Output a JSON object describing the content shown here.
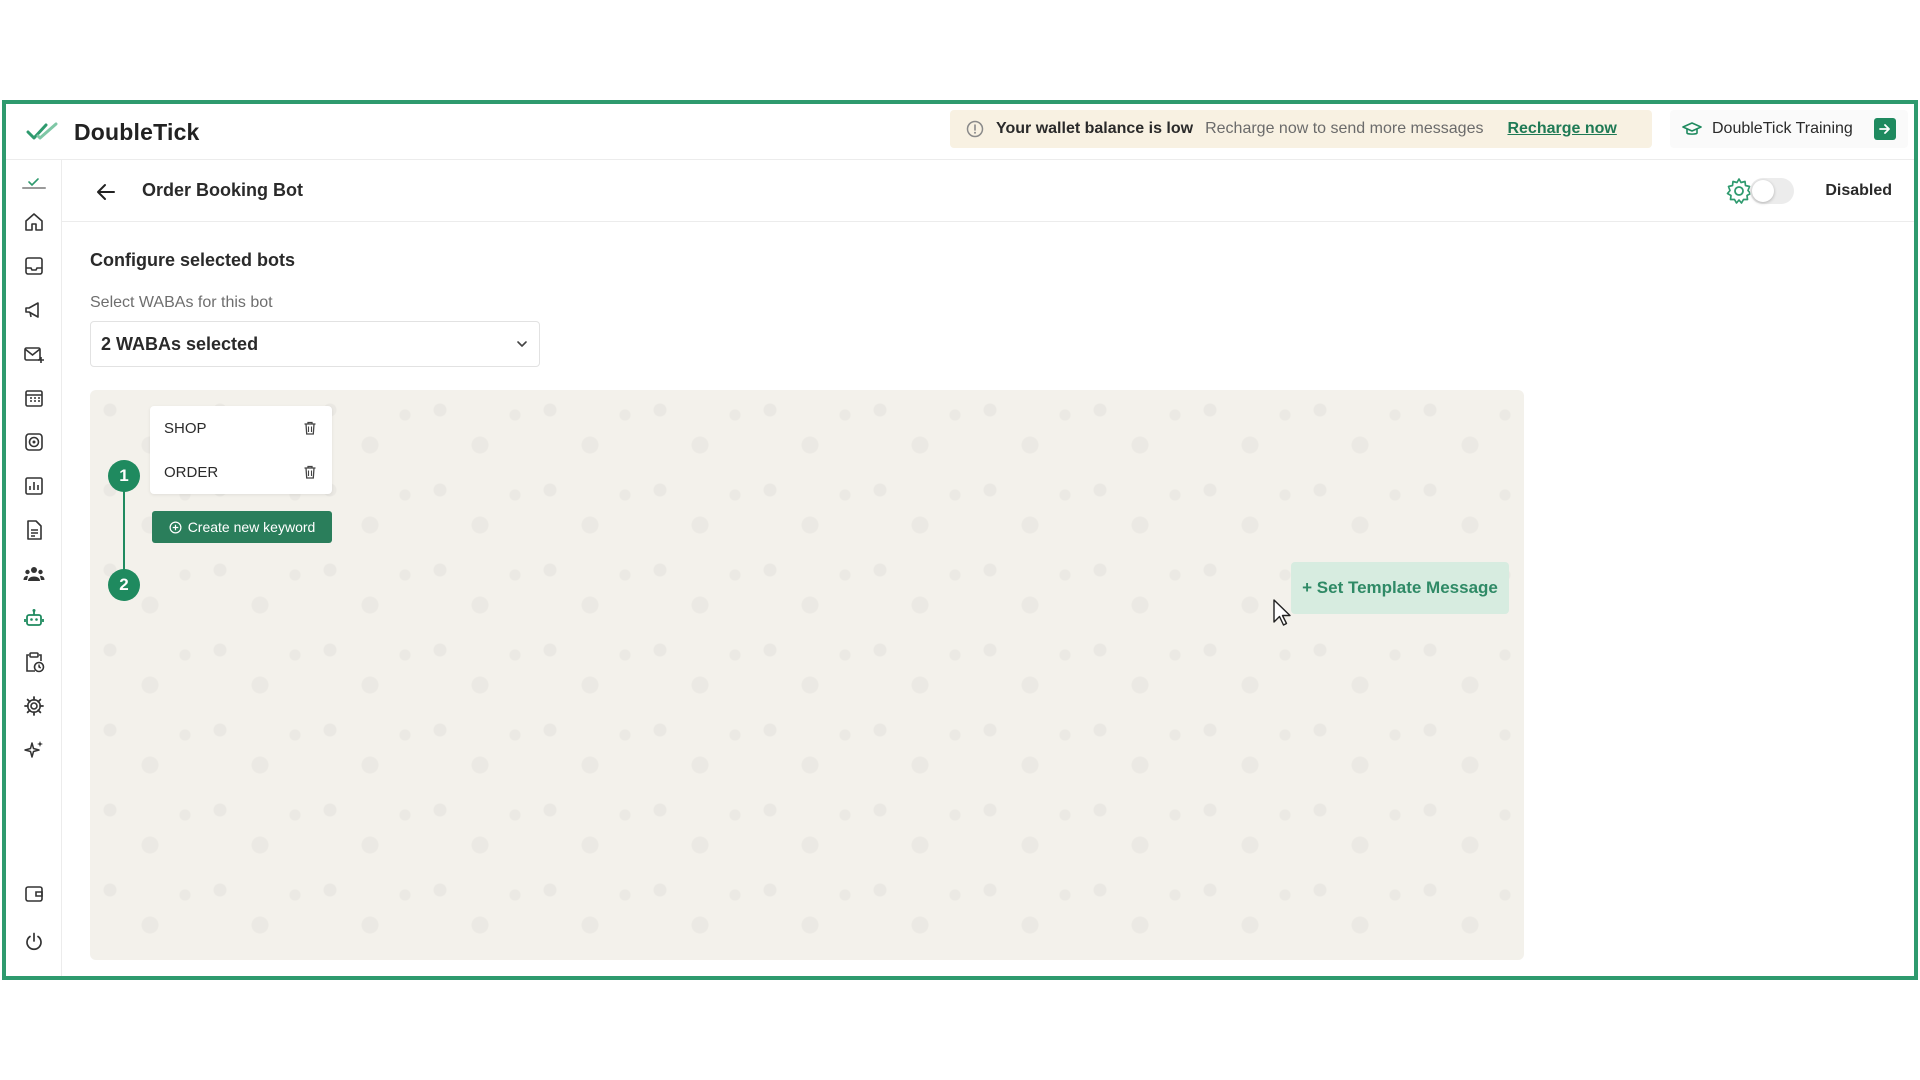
{
  "app": {
    "name": "DoubleTick",
    "accent": "#2e9a6e"
  },
  "banner": {
    "title": "Your wallet balance is low",
    "subtitle": "Recharge now to send more messages",
    "link": "Recharge now",
    "icon": "info-circle-icon"
  },
  "training": {
    "label": "DoubleTick Training",
    "icon": "graduation-cap-icon"
  },
  "sidebar": {
    "items": [
      {
        "name": "home-icon"
      },
      {
        "name": "inbox-icon"
      },
      {
        "name": "megaphone-icon"
      },
      {
        "name": "mail-add-icon"
      },
      {
        "name": "calendar-grid-icon"
      },
      {
        "name": "target-icon"
      },
      {
        "name": "chart-icon"
      },
      {
        "name": "document-icon"
      },
      {
        "name": "team-icon"
      },
      {
        "name": "bot-icon",
        "active": true
      },
      {
        "name": "clipboard-clock-icon"
      },
      {
        "name": "settings-icon"
      },
      {
        "name": "sparkle-icon"
      },
      {
        "name": "wallet-icon"
      },
      {
        "name": "power-icon"
      }
    ]
  },
  "header": {
    "title": "Order Booking Bot",
    "toggle_label": "Disabled",
    "enabled": false
  },
  "configure": {
    "title": "Configure selected bots",
    "waba_label": "Select WABAs for this bot",
    "waba_value": "2 WABAs selected"
  },
  "flow": {
    "steps": [
      "1",
      "2"
    ],
    "keywords": [
      "SHOP",
      "ORDER"
    ],
    "create_keyword": "Create new keyword",
    "template_button": "+ Set Template Message"
  }
}
